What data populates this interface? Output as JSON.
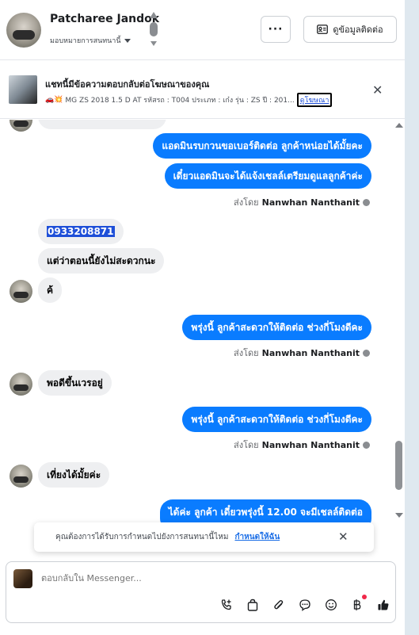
{
  "header": {
    "contact_name": "Patcharee Jandok",
    "assign_label": "มอบหมายการสนทนานี้",
    "more_label": "···",
    "contact_info_label": "ดูข้อมูลติดต่อ"
  },
  "ad_banner": {
    "title": "แชทนี้มีข้อความตอบกลับต่อโฆษณาของคุณ",
    "emojis": "🚗💥",
    "details": "MG ZS 2018 1.5 D AT รหัสรถ : T004 ประเภท : เก๋ง รุ่น : ZS ปี : 201...",
    "link_label": "ดูโฆษณา",
    "close_label": "✕"
  },
  "messages": {
    "out1": "แอดมินรบกวนขอเบอร์ติดต่อ ลูกค้าหน่อยได้มั้ยคะ",
    "out2": "เดี๋ยวแอดมินจะได้แจ้งเชลล์เตรียมดูแลลูกค้าค่ะ",
    "sent_by_prefix": "ส่งโดย",
    "sender_name": "Nanwhan Nanthanit",
    "in_phone": "0933208871",
    "in2": "แต่ว่าตอนนี้ยังไม่สะดวกนะ",
    "in3": "ค้",
    "out3": "พรุ่งนี้ ลูกค้าสะดวกให้ติดต่อ ช่วงกี่โมงดีคะ",
    "in4": "พอดีขึ้นเวรอยู่",
    "out4": "พรุ่งนี้ ลูกค้าสะดวกให้ติดต่อ ช่วงกี่โมงดีคะ",
    "in5": "เที่ยงได้มั้ยค่ะ",
    "out5": "ได้ค่ะ ลูกค้า เดี๋ยวพรุ่งนี้ 12.00 จะมีเชลล์ติดต่อ"
  },
  "notification": {
    "text": "คุณต้องการได้รับการกำหนดไปยังการสนทนานี้ไหม",
    "link": "กำหนดให้ฉัน",
    "close_label": "✕"
  },
  "composer": {
    "placeholder": "ตอบกลับใน Messenger..."
  },
  "icons": [
    "phone-plus-icon",
    "bag-icon",
    "paperclip-icon",
    "chat-bubble-icon",
    "smiley-icon",
    "baht-icon",
    "thumbs-up-icon"
  ],
  "colors": {
    "outgoing_bubble": "#0a7cff",
    "incoming_bubble": "#eeeff1",
    "link": "#1d6fe6",
    "notification_dot": "#f02849"
  }
}
